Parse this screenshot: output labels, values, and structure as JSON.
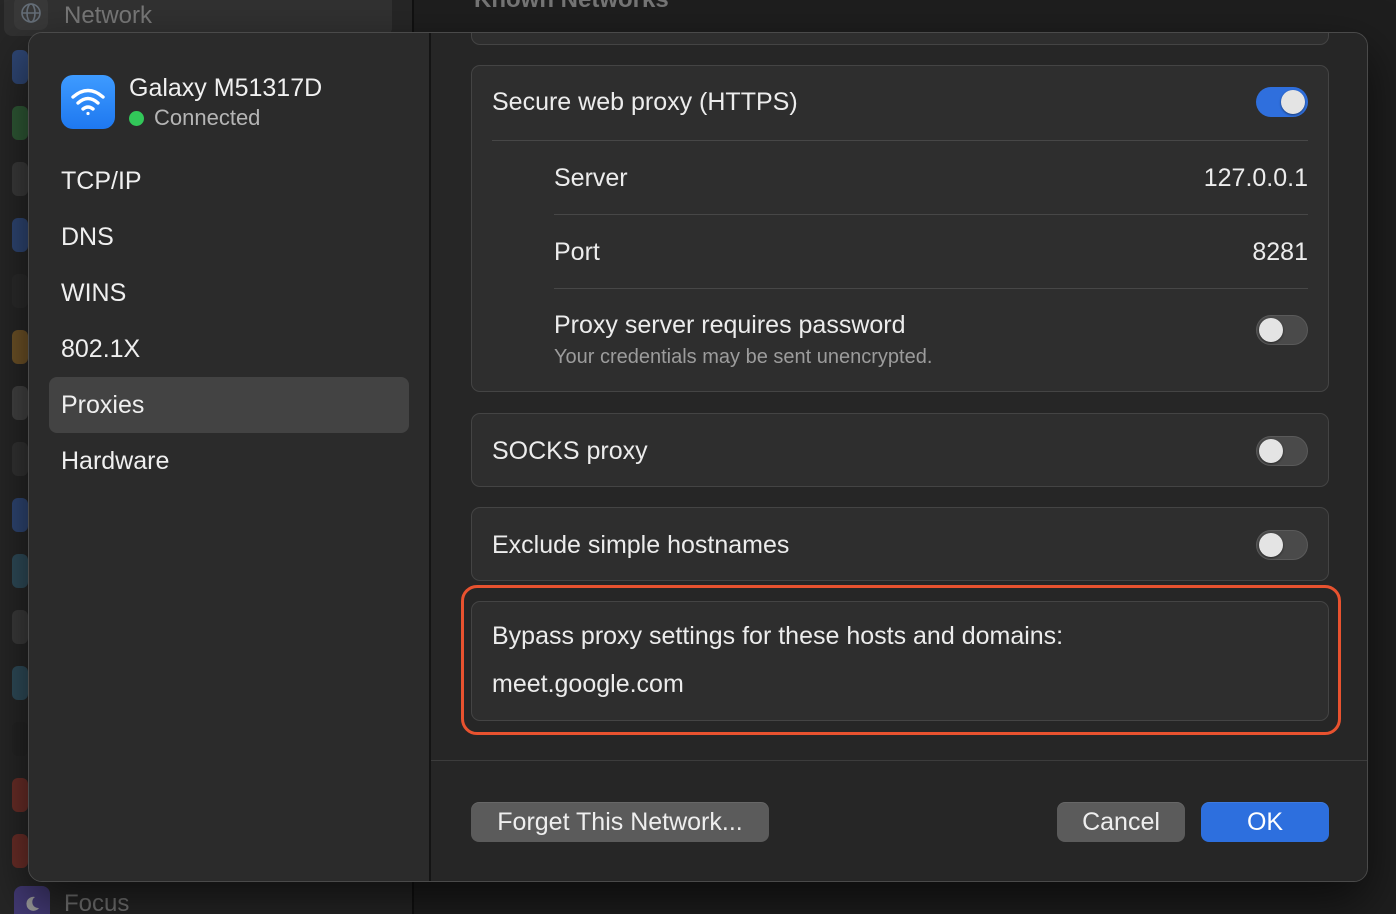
{
  "background": {
    "sidebar_title": "Network",
    "main_heading": "Known Networks",
    "sidebar_bottom_item": "Focus"
  },
  "sheet": {
    "network": {
      "name": "Galaxy M51317D",
      "status": "Connected"
    },
    "nav_items": [
      "TCP/IP",
      "DNS",
      "WINS",
      "802.1X",
      "Proxies",
      "Hardware"
    ],
    "selected_nav": "Proxies",
    "secure_web_proxy": {
      "label": "Secure web proxy (HTTPS)",
      "enabled": true,
      "server_label": "Server",
      "server_value": "127.0.0.1",
      "port_label": "Port",
      "port_value": "8281",
      "password_label": "Proxy server requires password",
      "password_note": "Your credentials may be sent unencrypted.",
      "password_required": false
    },
    "socks_proxy": {
      "label": "SOCKS proxy",
      "enabled": false
    },
    "exclude_simple": {
      "label": "Exclude simple hostnames",
      "enabled": false
    },
    "bypass": {
      "label": "Bypass proxy settings for these hosts and domains:",
      "value": "meet.google.com"
    },
    "buttons": {
      "forget": "Forget This Network...",
      "cancel": "Cancel",
      "ok": "OK"
    }
  },
  "colors": {
    "accent": "#2d6fde",
    "highlight_outline": "#e8522f",
    "connected": "#32c759"
  }
}
